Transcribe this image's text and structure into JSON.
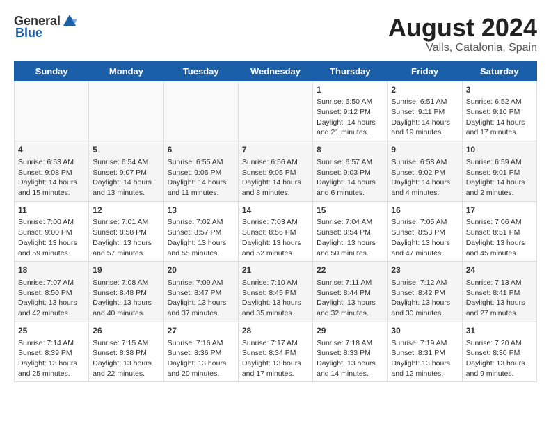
{
  "header": {
    "logo_general": "General",
    "logo_blue": "Blue",
    "title": "August 2024",
    "subtitle": "Valls, Catalonia, Spain"
  },
  "weekdays": [
    "Sunday",
    "Monday",
    "Tuesday",
    "Wednesday",
    "Thursday",
    "Friday",
    "Saturday"
  ],
  "weeks": [
    [
      {
        "day": "",
        "content": ""
      },
      {
        "day": "",
        "content": ""
      },
      {
        "day": "",
        "content": ""
      },
      {
        "day": "",
        "content": ""
      },
      {
        "day": "1",
        "content": "Sunrise: 6:50 AM\nSunset: 9:12 PM\nDaylight: 14 hours\nand 21 minutes."
      },
      {
        "day": "2",
        "content": "Sunrise: 6:51 AM\nSunset: 9:11 PM\nDaylight: 14 hours\nand 19 minutes."
      },
      {
        "day": "3",
        "content": "Sunrise: 6:52 AM\nSunset: 9:10 PM\nDaylight: 14 hours\nand 17 minutes."
      }
    ],
    [
      {
        "day": "4",
        "content": "Sunrise: 6:53 AM\nSunset: 9:08 PM\nDaylight: 14 hours\nand 15 minutes."
      },
      {
        "day": "5",
        "content": "Sunrise: 6:54 AM\nSunset: 9:07 PM\nDaylight: 14 hours\nand 13 minutes."
      },
      {
        "day": "6",
        "content": "Sunrise: 6:55 AM\nSunset: 9:06 PM\nDaylight: 14 hours\nand 11 minutes."
      },
      {
        "day": "7",
        "content": "Sunrise: 6:56 AM\nSunset: 9:05 PM\nDaylight: 14 hours\nand 8 minutes."
      },
      {
        "day": "8",
        "content": "Sunrise: 6:57 AM\nSunset: 9:03 PM\nDaylight: 14 hours\nand 6 minutes."
      },
      {
        "day": "9",
        "content": "Sunrise: 6:58 AM\nSunset: 9:02 PM\nDaylight: 14 hours\nand 4 minutes."
      },
      {
        "day": "10",
        "content": "Sunrise: 6:59 AM\nSunset: 9:01 PM\nDaylight: 14 hours\nand 2 minutes."
      }
    ],
    [
      {
        "day": "11",
        "content": "Sunrise: 7:00 AM\nSunset: 9:00 PM\nDaylight: 13 hours\nand 59 minutes."
      },
      {
        "day": "12",
        "content": "Sunrise: 7:01 AM\nSunset: 8:58 PM\nDaylight: 13 hours\nand 57 minutes."
      },
      {
        "day": "13",
        "content": "Sunrise: 7:02 AM\nSunset: 8:57 PM\nDaylight: 13 hours\nand 55 minutes."
      },
      {
        "day": "14",
        "content": "Sunrise: 7:03 AM\nSunset: 8:56 PM\nDaylight: 13 hours\nand 52 minutes."
      },
      {
        "day": "15",
        "content": "Sunrise: 7:04 AM\nSunset: 8:54 PM\nDaylight: 13 hours\nand 50 minutes."
      },
      {
        "day": "16",
        "content": "Sunrise: 7:05 AM\nSunset: 8:53 PM\nDaylight: 13 hours\nand 47 minutes."
      },
      {
        "day": "17",
        "content": "Sunrise: 7:06 AM\nSunset: 8:51 PM\nDaylight: 13 hours\nand 45 minutes."
      }
    ],
    [
      {
        "day": "18",
        "content": "Sunrise: 7:07 AM\nSunset: 8:50 PM\nDaylight: 13 hours\nand 42 minutes."
      },
      {
        "day": "19",
        "content": "Sunrise: 7:08 AM\nSunset: 8:48 PM\nDaylight: 13 hours\nand 40 minutes."
      },
      {
        "day": "20",
        "content": "Sunrise: 7:09 AM\nSunset: 8:47 PM\nDaylight: 13 hours\nand 37 minutes."
      },
      {
        "day": "21",
        "content": "Sunrise: 7:10 AM\nSunset: 8:45 PM\nDaylight: 13 hours\nand 35 minutes."
      },
      {
        "day": "22",
        "content": "Sunrise: 7:11 AM\nSunset: 8:44 PM\nDaylight: 13 hours\nand 32 minutes."
      },
      {
        "day": "23",
        "content": "Sunrise: 7:12 AM\nSunset: 8:42 PM\nDaylight: 13 hours\nand 30 minutes."
      },
      {
        "day": "24",
        "content": "Sunrise: 7:13 AM\nSunset: 8:41 PM\nDaylight: 13 hours\nand 27 minutes."
      }
    ],
    [
      {
        "day": "25",
        "content": "Sunrise: 7:14 AM\nSunset: 8:39 PM\nDaylight: 13 hours\nand 25 minutes."
      },
      {
        "day": "26",
        "content": "Sunrise: 7:15 AM\nSunset: 8:38 PM\nDaylight: 13 hours\nand 22 minutes."
      },
      {
        "day": "27",
        "content": "Sunrise: 7:16 AM\nSunset: 8:36 PM\nDaylight: 13 hours\nand 20 minutes."
      },
      {
        "day": "28",
        "content": "Sunrise: 7:17 AM\nSunset: 8:34 PM\nDaylight: 13 hours\nand 17 minutes."
      },
      {
        "day": "29",
        "content": "Sunrise: 7:18 AM\nSunset: 8:33 PM\nDaylight: 13 hours\nand 14 minutes."
      },
      {
        "day": "30",
        "content": "Sunrise: 7:19 AM\nSunset: 8:31 PM\nDaylight: 13 hours\nand 12 minutes."
      },
      {
        "day": "31",
        "content": "Sunrise: 7:20 AM\nSunset: 8:30 PM\nDaylight: 13 hours\nand 9 minutes."
      }
    ]
  ]
}
